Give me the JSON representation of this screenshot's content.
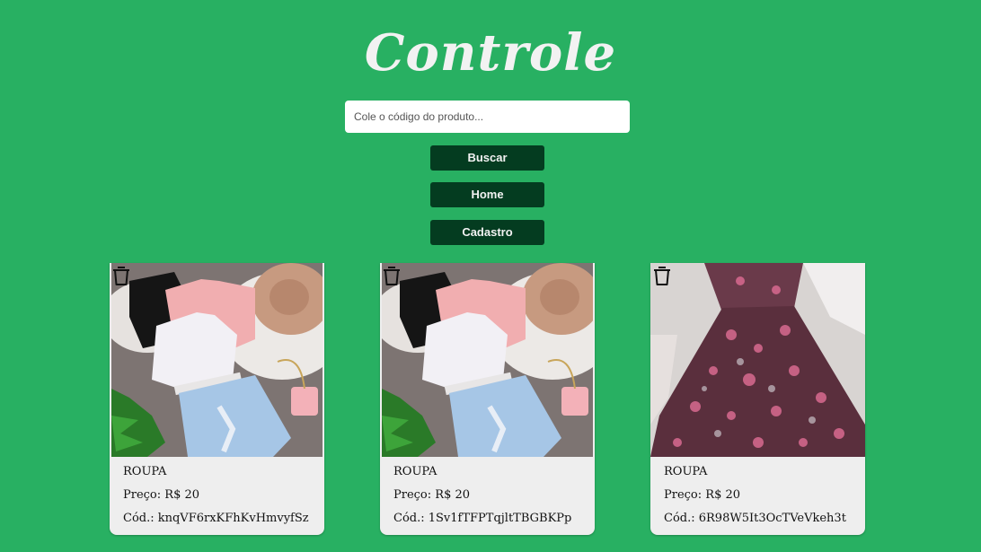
{
  "header": {
    "title": "Controle"
  },
  "search": {
    "placeholder": "Cole o código do produto..."
  },
  "buttons": {
    "search": "Buscar",
    "home": "Home",
    "register": "Cadastro"
  },
  "colors": {
    "background": "#28b062",
    "button": "#043c20",
    "card": "#eeeeee"
  },
  "products": [
    {
      "category": "ROUPA",
      "price": "Preço: R$ 20",
      "code": "Cód.: knqVF6rxKFhKvHmvyfSz",
      "image": "outfit-flatlay",
      "delete_icon": "trash-icon"
    },
    {
      "category": "ROUPA",
      "price": "Preço: R$ 20",
      "code": "Cód.: 1Sv1fTFPTqjltTBGBKPp",
      "image": "outfit-flatlay",
      "delete_icon": "trash-icon"
    },
    {
      "category": "ROUPA",
      "price": "Preço: R$ 20",
      "code": "Cód.: 6R98W5It3OcTVeVkeh3t",
      "image": "floral-dress",
      "delete_icon": "trash-icon"
    }
  ]
}
